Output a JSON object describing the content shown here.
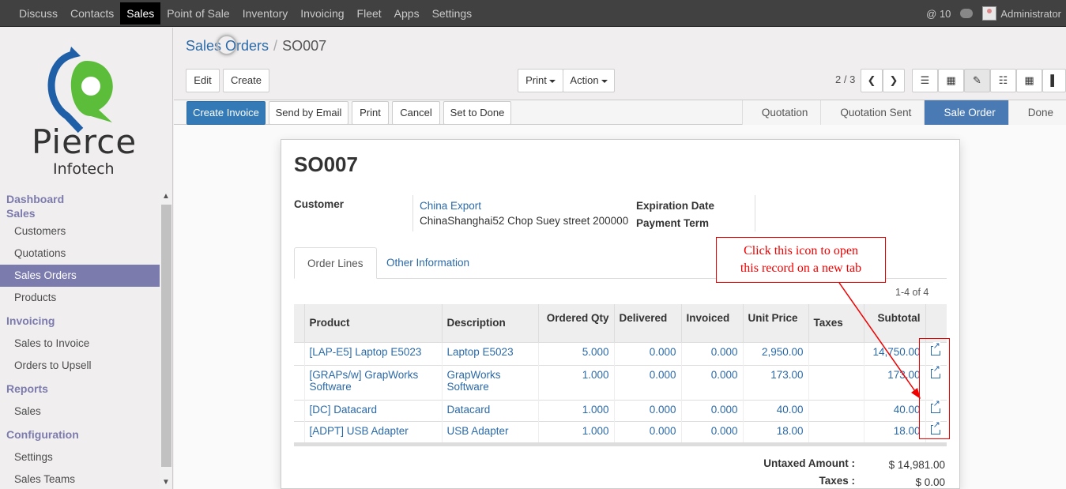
{
  "topnav": {
    "items": [
      "Discuss",
      "Contacts",
      "Sales",
      "Point of Sale",
      "Inventory",
      "Invoicing",
      "Fleet",
      "Apps",
      "Settings"
    ],
    "active": "Sales",
    "mentions": "@ 10",
    "user": "Administrator"
  },
  "logo": {
    "name": "Pierce",
    "sub": "Infotech"
  },
  "sidebar": {
    "sections": [
      {
        "title": "Dashboard"
      },
      {
        "title": "Sales",
        "items": [
          "Customers",
          "Quotations",
          "Sales Orders",
          "Products"
        ]
      },
      {
        "title": "Invoicing",
        "items": [
          "Sales to Invoice",
          "Orders to Upsell"
        ]
      },
      {
        "title": "Reports",
        "items": [
          "Sales"
        ]
      },
      {
        "title": "Configuration",
        "items": [
          "Settings",
          "Sales Teams"
        ]
      }
    ],
    "active_item": "Sales Orders"
  },
  "breadcrumb": {
    "parent": "Sales Orders",
    "separator": "/",
    "current": "SO007"
  },
  "toolbar": {
    "edit": "Edit",
    "create": "Create",
    "print": "Print",
    "action": "Action",
    "pager": "2 / 3"
  },
  "statusbar": {
    "buttons": [
      "Create Invoice",
      "Send by Email",
      "Print",
      "Cancel",
      "Set to Done"
    ],
    "stages": [
      "Quotation",
      "Quotation Sent",
      "Sale Order",
      "Done"
    ],
    "active_stage": "Sale Order"
  },
  "record": {
    "name": "SO007",
    "customer_label": "Customer",
    "customer_name": "China Export",
    "customer_address": "ChinaShanghai52 Chop Suey street 200000",
    "expiration_label": "Expiration Date",
    "payment_label": "Payment Term"
  },
  "tabs": [
    "Order Lines",
    "Other Information"
  ],
  "lines": {
    "count": "1-4 of 4",
    "columns": [
      "Product",
      "Description",
      "Ordered Qty",
      "Delivered",
      "Invoiced",
      "Unit Price",
      "Taxes",
      "Subtotal"
    ],
    "rows": [
      {
        "product": "[LAP-E5] Laptop E5023",
        "description": "Laptop E5023",
        "qty": "5.000",
        "delivered": "0.000",
        "invoiced": "0.000",
        "price": "2,950.00",
        "taxes": "",
        "subtotal": "14,750.00"
      },
      {
        "product": "[GRAPs/w] GrapWorks Software",
        "description": "GrapWorks Software",
        "qty": "1.000",
        "delivered": "0.000",
        "invoiced": "0.000",
        "price": "173.00",
        "taxes": "",
        "subtotal": "173.00"
      },
      {
        "product": "[DC] Datacard",
        "description": "Datacard",
        "qty": "1.000",
        "delivered": "0.000",
        "invoiced": "0.000",
        "price": "40.00",
        "taxes": "",
        "subtotal": "40.00"
      },
      {
        "product": "[ADPT] USB Adapter",
        "description": "USB Adapter",
        "qty": "1.000",
        "delivered": "0.000",
        "invoiced": "0.000",
        "price": "18.00",
        "taxes": "",
        "subtotal": "18.00"
      }
    ]
  },
  "totals": {
    "untaxed_label": "Untaxed Amount :",
    "untaxed_value": "$ 14,981.00",
    "taxes_label": "Taxes :",
    "taxes_value": "$ 0.00"
  },
  "annotation": {
    "line1": "Click this icon to open",
    "line2": "this record on a new tab",
    "color": "#e00000"
  }
}
